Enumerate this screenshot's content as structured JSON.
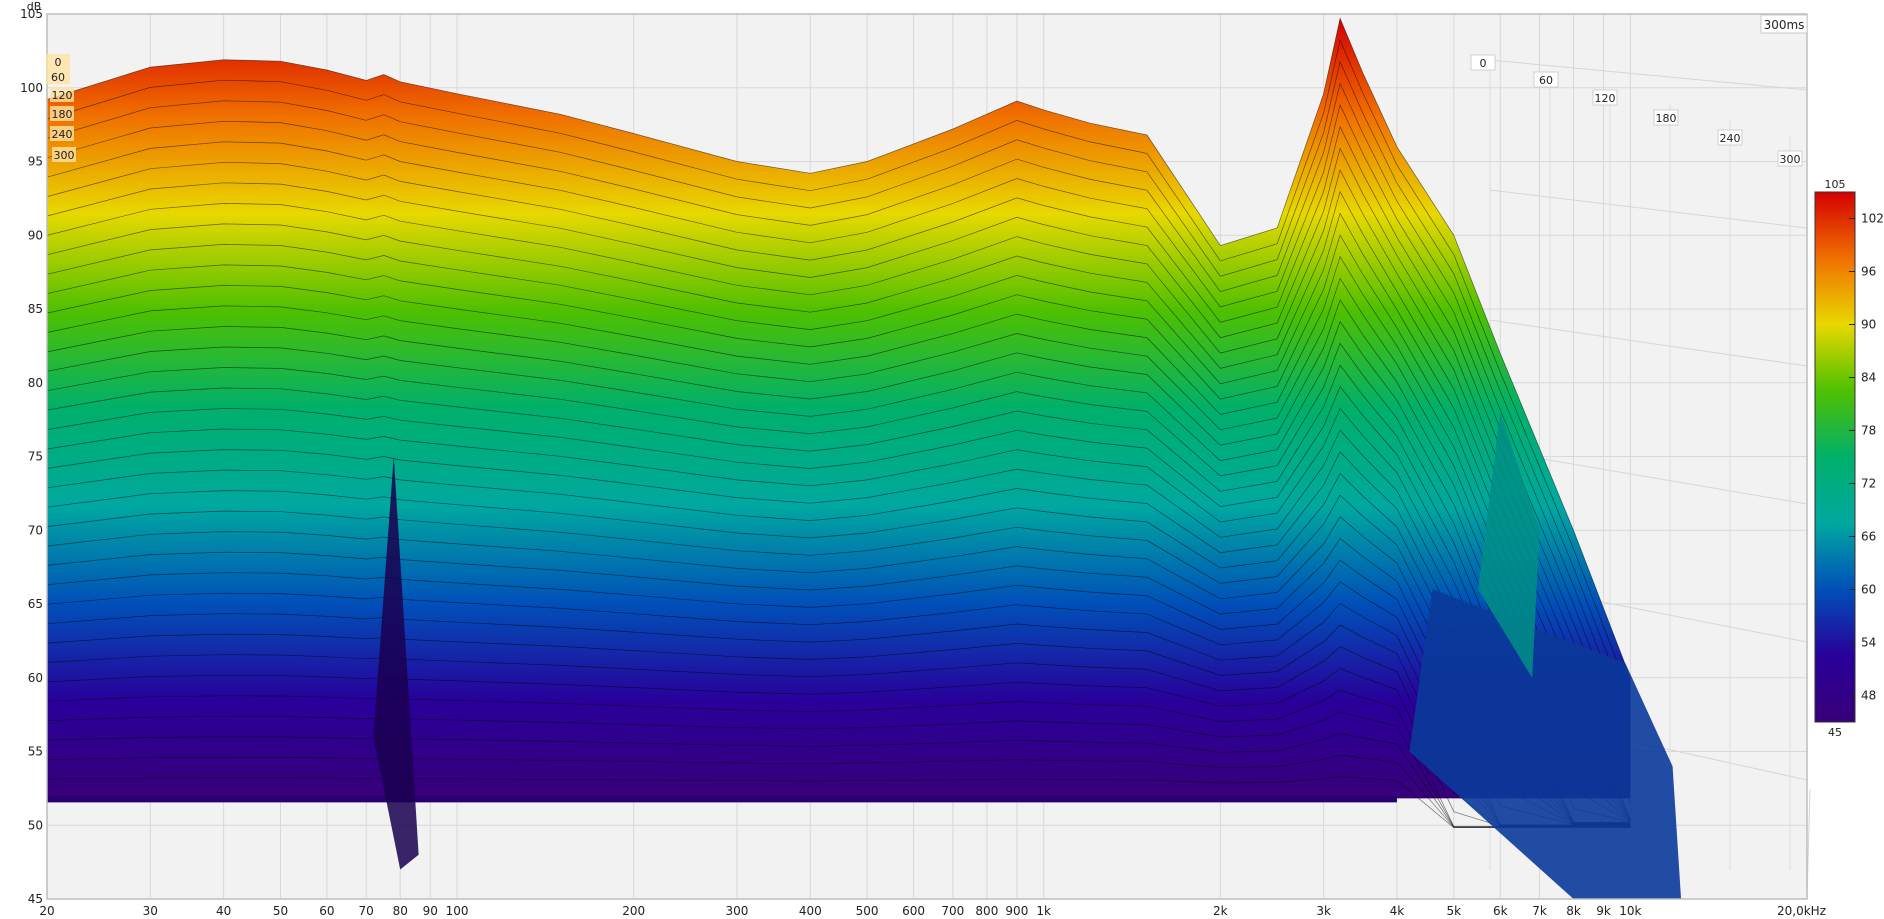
{
  "chart_data": {
    "type": "area",
    "title": "",
    "xlabel": "",
    "ylabel": "dB",
    "x_scale": "log",
    "xlim": [
      20,
      20000
    ],
    "ylim": [
      45,
      105
    ],
    "x_ticks": [
      {
        "value": 20,
        "label": "20"
      },
      {
        "value": 30,
        "label": "30"
      },
      {
        "value": 40,
        "label": "40"
      },
      {
        "value": 50,
        "label": "50"
      },
      {
        "value": 60,
        "label": "60"
      },
      {
        "value": 70,
        "label": "70"
      },
      {
        "value": 80,
        "label": "80"
      },
      {
        "value": 90,
        "label": "90"
      },
      {
        "value": 100,
        "label": "100"
      },
      {
        "value": 200,
        "label": "200"
      },
      {
        "value": 300,
        "label": "300"
      },
      {
        "value": 400,
        "label": "400"
      },
      {
        "value": 500,
        "label": "500"
      },
      {
        "value": 600,
        "label": "600"
      },
      {
        "value": 700,
        "label": "700"
      },
      {
        "value": 800,
        "label": "800"
      },
      {
        "value": 900,
        "label": "900"
      },
      {
        "value": 1000,
        "label": "1k"
      },
      {
        "value": 2000,
        "label": "2k"
      },
      {
        "value": 3000,
        "label": "3k"
      },
      {
        "value": 4000,
        "label": "4k"
      },
      {
        "value": 5000,
        "label": "5k"
      },
      {
        "value": 6000,
        "label": "6k"
      },
      {
        "value": 7000,
        "label": "7k"
      },
      {
        "value": 8000,
        "label": "8k"
      },
      {
        "value": 9000,
        "label": "9k"
      },
      {
        "value": 10000,
        "label": "10k"
      },
      {
        "value": 20000,
        "label": "20,0kHz"
      }
    ],
    "y_ticks": [
      45,
      50,
      55,
      60,
      65,
      70,
      75,
      80,
      85,
      90,
      95,
      100,
      105
    ],
    "time_axis": {
      "unit_label": "300ms",
      "ticks": [
        "0",
        "60",
        "120",
        "180",
        "240",
        "300"
      ],
      "left_ticks": [
        "0",
        "60",
        "120",
        "180",
        "240",
        "300"
      ]
    },
    "colorbar": {
      "min_label": "45",
      "max_label": "105",
      "ticks": [
        "102",
        "96",
        "90",
        "84",
        "78",
        "72",
        "66",
        "60",
        "54",
        "48"
      ],
      "colors": [
        "#d40000",
        "#f07000",
        "#e8d800",
        "#4ec000",
        "#00b06a",
        "#00a8a0",
        "#0050b8",
        "#28009a",
        "#38007a"
      ]
    },
    "series": [
      {
        "time_ms": 0,
        "x": [
          20,
          30,
          40,
          50,
          60,
          70,
          75,
          80,
          100,
          150,
          200,
          300,
          400,
          500,
          700,
          900,
          1000,
          1200,
          1500,
          2000,
          2500,
          3000,
          3200,
          3500,
          4000,
          5000,
          6000,
          8000,
          10000
        ],
        "y": [
          99.2,
          101.4,
          101.9,
          101.8,
          101.2,
          100.5,
          100.9,
          100.4,
          99.6,
          98.2,
          96.9,
          95.0,
          94.2,
          95.0,
          97.2,
          99.1,
          98.5,
          97.6,
          96.8,
          89.3,
          90.5,
          99.6,
          104.7,
          101.0,
          96.0,
          90.0,
          82.0,
          70.0,
          60.0
        ]
      }
    ],
    "surface": "cumulative spectral decay waterfall; successive slices from 0 ms to 300 ms drawn behind one another, each decaying toward the 45 dB floor"
  }
}
